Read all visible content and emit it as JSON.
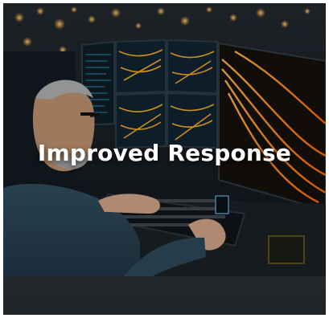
{
  "card": {
    "title": "Improved Response",
    "title_color": "#ffffff",
    "band_color": "#232629"
  },
  "image": {
    "subject": "operator-at-traffic-monitoring-workstation",
    "icons": [
      "monitor-icon",
      "keyboard-icon",
      "traffic-light-trails-icon"
    ]
  }
}
